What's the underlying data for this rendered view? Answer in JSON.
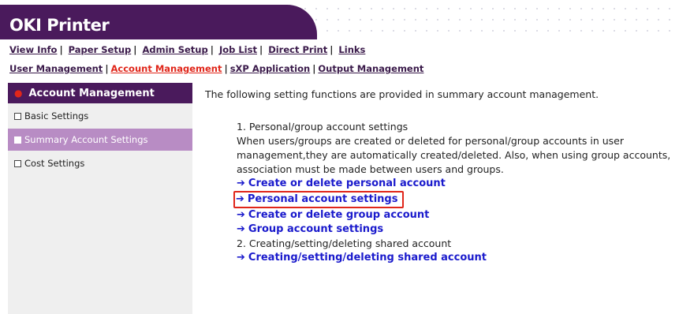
{
  "app": {
    "title": "OKI Printer"
  },
  "nav": {
    "row1": [
      "View Info",
      "Paper Setup",
      "Admin Setup",
      "Job List",
      "Direct Print",
      "Links"
    ],
    "row2": [
      "User Management",
      "Account Management",
      "sXP Application",
      "Output Management"
    ],
    "active": "Account Management"
  },
  "sidebar": {
    "title": "Account Management",
    "items": [
      {
        "label": "Basic Settings"
      },
      {
        "label": "Summary Account Settings"
      },
      {
        "label": "Cost Settings"
      }
    ],
    "active_index": 1
  },
  "main": {
    "intro": "The following setting functions are provided in summary account management.",
    "section1": {
      "heading": "1. Personal/group account settings",
      "body": "When users/groups are created or deleted for personal/group accounts in user management,they are automatically created/deleted. Also, when using group accounts, association must be made between users and groups.",
      "links": [
        "Create or delete personal account",
        "Personal account settings",
        "Create or delete group account",
        "Group account settings"
      ]
    },
    "section2": {
      "heading": "2. Creating/setting/deleting shared account",
      "links": [
        "Creating/setting/deleting shared account"
      ]
    },
    "link_arrow": "➔"
  },
  "colors": {
    "brand": "#4a1a5c",
    "active_nav": "#e0261a",
    "link": "#1a1acc",
    "highlight_border": "#e0261a",
    "sidebar_active": "#b88cc4"
  },
  "icons": {
    "sidebar_bullet": "square-bullet-icon",
    "title_bullet": "red-dot-icon",
    "link_arrow": "arrow-right-icon"
  }
}
